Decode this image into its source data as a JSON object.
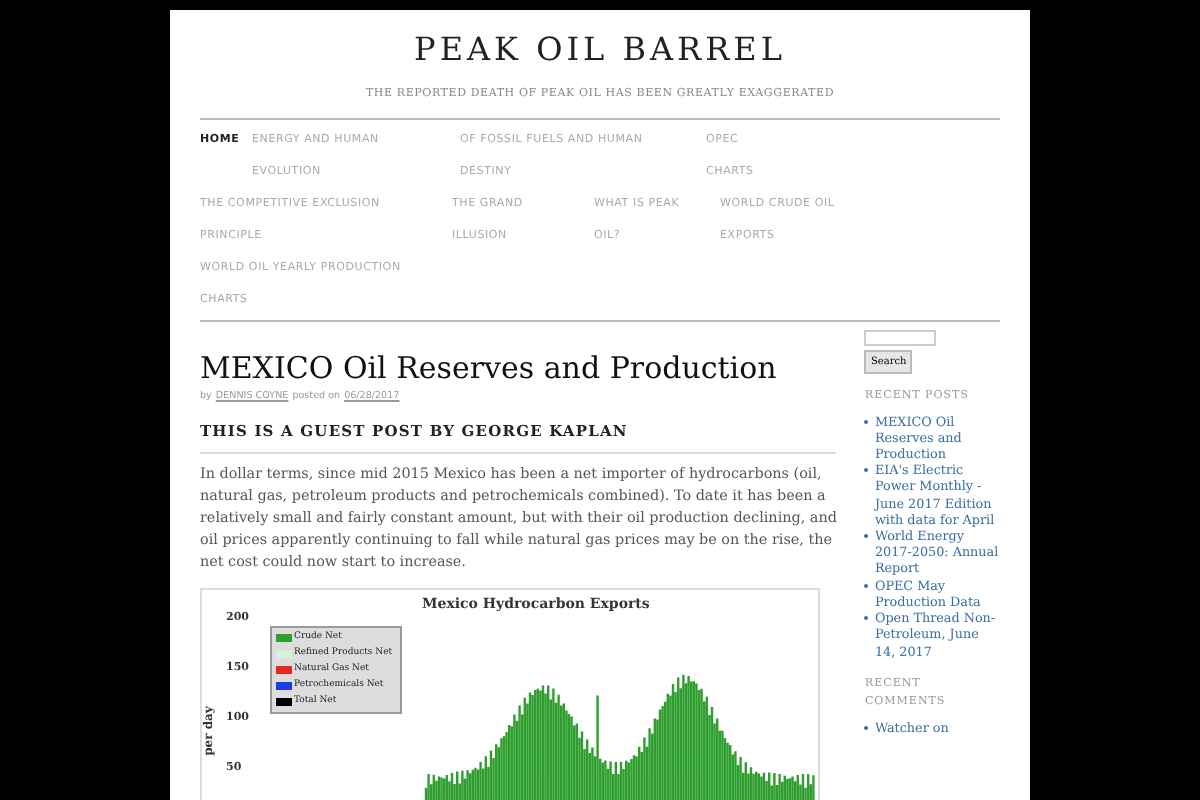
{
  "site": {
    "title": "PEAK OIL BARREL",
    "tagline": "THE REPORTED DEATH OF PEAK OIL HAS BEEN GREATLY EXAGGERATED"
  },
  "nav": [
    {
      "label": "HOME",
      "selected": true
    },
    {
      "label": "ENERGY AND HUMAN EVOLUTION",
      "selected": false
    },
    {
      "label": "OF FOSSIL FUELS AND HUMAN DESTINY",
      "selected": false
    },
    {
      "label": "OPEC CHARTS",
      "selected": false
    },
    {
      "label": "THE COMPETITIVE EXCLUSION PRINCIPLE",
      "selected": false
    },
    {
      "label": "THE GRAND ILLUSION",
      "selected": false
    },
    {
      "label": "WHAT IS PEAK OIL?",
      "selected": false
    },
    {
      "label": "WORLD CRUDE OIL EXPORTS",
      "selected": false
    },
    {
      "label": "WORLD OIL YEARLY PRODUCTION CHARTS",
      "selected": false
    }
  ],
  "post": {
    "title": "MEXICO Oil Reserves and Production",
    "by": "by",
    "author": "DENNIS COYNE",
    "posted_on": "posted on",
    "date": "06/28/2017",
    "subtitle": "THIS IS A GUEST POST BY GEORGE KAPLAN",
    "body": "In dollar terms, since mid 2015 Mexico has been a net importer of hydrocarbons (oil, natural gas, petroleum products and petrochemicals combined). To date it has been a relatively small and fairly constant amount, but with their oil production declining, and oil prices apparently continuing to fall while natural gas prices may be on the rise, the net cost could now start to increase.",
    "figure": {
      "title": "Mexico Hydrocarbon Exports",
      "ylabel": "per day",
      "yticks": [
        "200",
        "150",
        "100",
        "50"
      ],
      "legend": [
        {
          "label": "Crude Net",
          "color": "#2e9e2e"
        },
        {
          "label": "Refined Products Net",
          "color": "#d8f0d8"
        },
        {
          "label": "Natural Gas Net",
          "color": "#e8281e"
        },
        {
          "label": "Petrochemicals Net",
          "color": "#1e3ce8"
        },
        {
          "label": "Total Net",
          "color": "#000000"
        }
      ]
    }
  },
  "sidebar": {
    "search_button": "Search",
    "recent_posts_title": "RECENT POSTS",
    "recent_posts": [
      "MEXICO Oil Reserves and Production",
      "EIA's Electric Power Monthly - June 2017 Edition with data for April",
      "World Energy 2017-2050: Annual Report",
      "OPEC May Production Data",
      "Open Thread Non-Petroleum, June 14, 2017"
    ],
    "recent_comments_title": "RECENT COMMENTS",
    "recent_comments": [
      "Watcher on"
    ]
  }
}
